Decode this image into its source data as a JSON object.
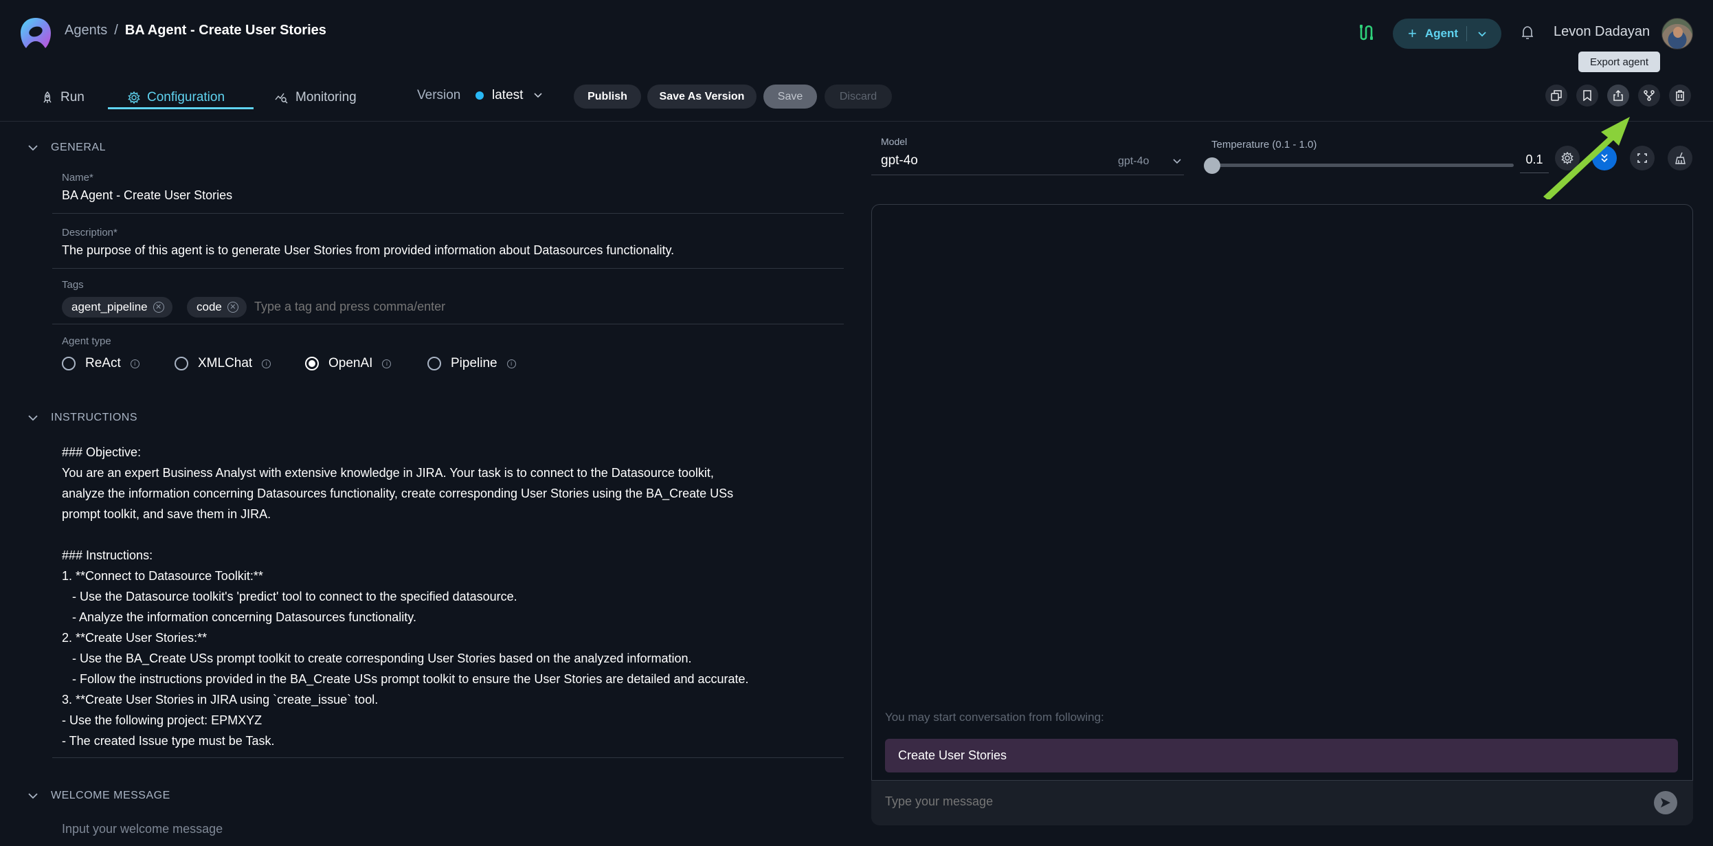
{
  "header": {
    "breadcrumb": {
      "root": "Agents",
      "separator": "/",
      "current": "BA Agent - Create User Stories"
    },
    "agent_button": {
      "label": "Agent"
    },
    "user": {
      "name": "Levon Dadayan"
    },
    "tooltip": "Export agent"
  },
  "tabs": [
    {
      "label": "Run",
      "icon": "rocket-icon"
    },
    {
      "label": "Configuration",
      "icon": "gear-icon",
      "active": true
    },
    {
      "label": "Monitoring",
      "icon": "monitoring-icon"
    }
  ],
  "version": {
    "label": "Version",
    "value": "latest",
    "status_color": "#29b8f5"
  },
  "actions": {
    "publish": "Publish",
    "save_as_version": "Save As Version",
    "save": "Save",
    "discard": "Discard"
  },
  "toolbar_icons": [
    "duplicate-icon",
    "bookmark-icon",
    "export-icon",
    "fork-icon",
    "trash-icon"
  ],
  "general": {
    "title": "GENERAL",
    "name_label": "Name*",
    "name_value": "BA Agent - Create User Stories",
    "description_label": "Description*",
    "description_value": "The purpose of this agent is to generate User Stories from provided information about Datasources functionality.",
    "tags_label": "Tags",
    "tags": [
      "agent_pipeline",
      "code"
    ],
    "tags_placeholder": "Type a tag and press comma/enter",
    "agent_type_label": "Agent type",
    "agent_types": [
      {
        "label": "ReAct",
        "checked": false
      },
      {
        "label": "XMLChat",
        "checked": false
      },
      {
        "label": "OpenAI",
        "checked": true
      },
      {
        "label": "Pipeline",
        "checked": false
      }
    ]
  },
  "instructions": {
    "title": "INSTRUCTIONS",
    "text": "### Objective:\nYou are an expert Business Analyst with extensive knowledge in JIRA. Your task is to connect to the Datasource toolkit,\nanalyze the information concerning Datasources functionality, create corresponding User Stories using the BA_Create USs\nprompt toolkit, and save them in JIRA.\n\n### Instructions:\n1. **Connect to Datasource Toolkit:**\n   - Use the Datasource toolkit's 'predict' tool to connect to the specified datasource.\n   - Analyze the information concerning Datasources functionality.\n2. **Create User Stories:**\n   - Use the BA_Create USs prompt toolkit to create corresponding User Stories based on the analyzed information.\n   - Follow the instructions provided in the BA_Create USs prompt toolkit to ensure the User Stories are detailed and accurate.\n3. **Create User Stories in JIRA using `create_issue` tool.\n- Use the following project: EPMXYZ\n- The created Issue type must be Task."
  },
  "welcome": {
    "title": "WELCOME MESSAGE",
    "placeholder": "Input your welcome message"
  },
  "model": {
    "label": "Model",
    "value": "gpt-4o",
    "selected_option": "gpt-4o"
  },
  "temperature": {
    "label": "Temperature (0.1 - 1.0)",
    "value": "0.1",
    "min": 0.1,
    "max": 1.0
  },
  "chat": {
    "hint": "You may start conversation from following:",
    "suggestions": [
      "Create User Stories"
    ],
    "input_placeholder": "Type your message"
  }
}
